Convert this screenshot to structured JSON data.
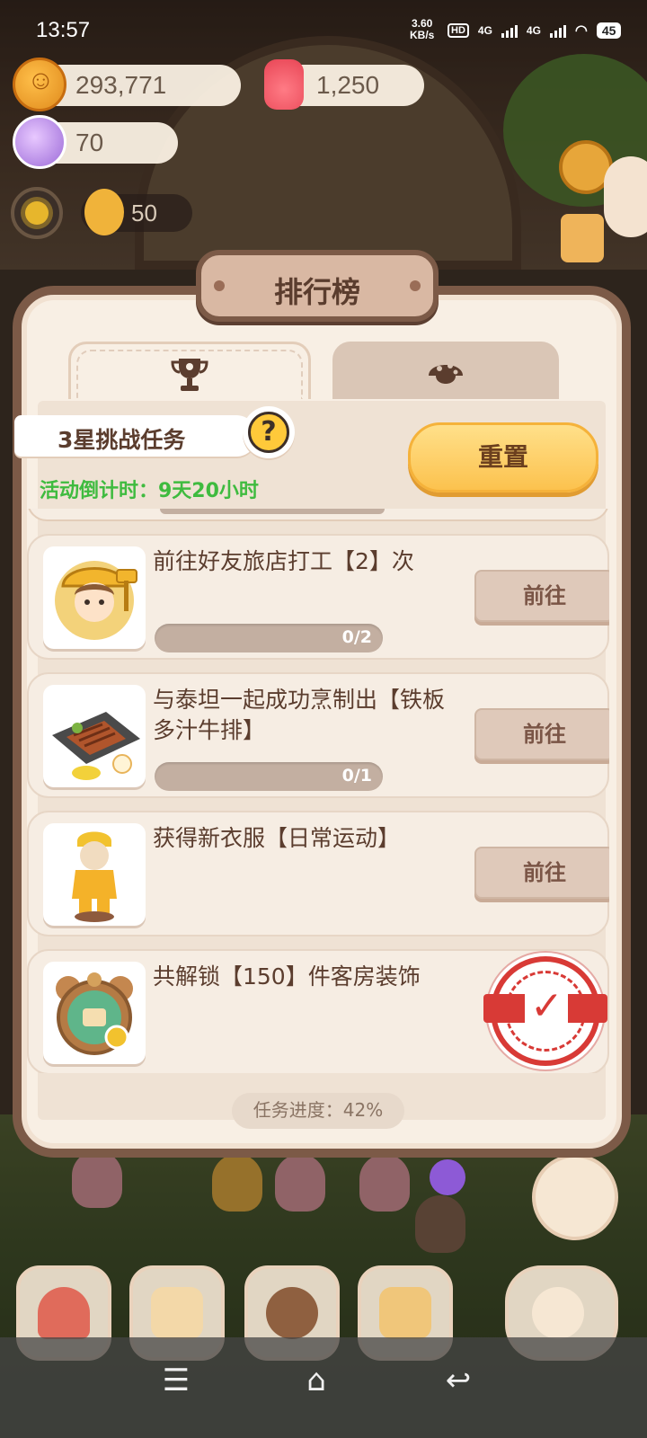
{
  "status_bar": {
    "time": "13:57",
    "net_speed_value": "3.60",
    "net_speed_unit": "KB/s",
    "hd": "HD",
    "sim1": "4G",
    "sim2": "4G",
    "battery": "45"
  },
  "resources": {
    "coins": "293,771",
    "candles": "1,250",
    "gems": "70",
    "level_value": "50"
  },
  "panel": {
    "title": "排行榜",
    "tabs": [
      {
        "icon": "trophy-icon",
        "active": true
      },
      {
        "icon": "mushroom-icon",
        "active": false
      }
    ],
    "challenge_label": "3星挑战任务",
    "help_label": "?",
    "countdown": "活动倒计时：9天20小时",
    "reset_button": "重置",
    "progress_text": "任务进度：42%"
  },
  "tasks": [
    {
      "title": "前往好友旅店打工【2】次",
      "progress_text": "0/2",
      "progress": 0,
      "button": "前往",
      "completed": false
    },
    {
      "title": "与泰坦一起成功烹制出【铁板多汁牛排】",
      "progress_text": "0/1",
      "progress": 0,
      "button": "前往",
      "completed": false
    },
    {
      "title": "获得新衣服【日常运动】",
      "progress_text": "",
      "progress": null,
      "button": "前往",
      "completed": false
    },
    {
      "title": "共解锁【150】件客房装饰",
      "progress_text": "",
      "progress": null,
      "button": "",
      "completed": true
    }
  ],
  "nav_bar": {
    "menu_icon": "☰",
    "home_icon": "⌂",
    "back_icon": "↩"
  },
  "colors": {
    "panel_border": "#7c5a47",
    "countdown_green": "#3fbb3f",
    "reset_yellow": "#fcc24e",
    "stamp_red": "#d83a36"
  }
}
